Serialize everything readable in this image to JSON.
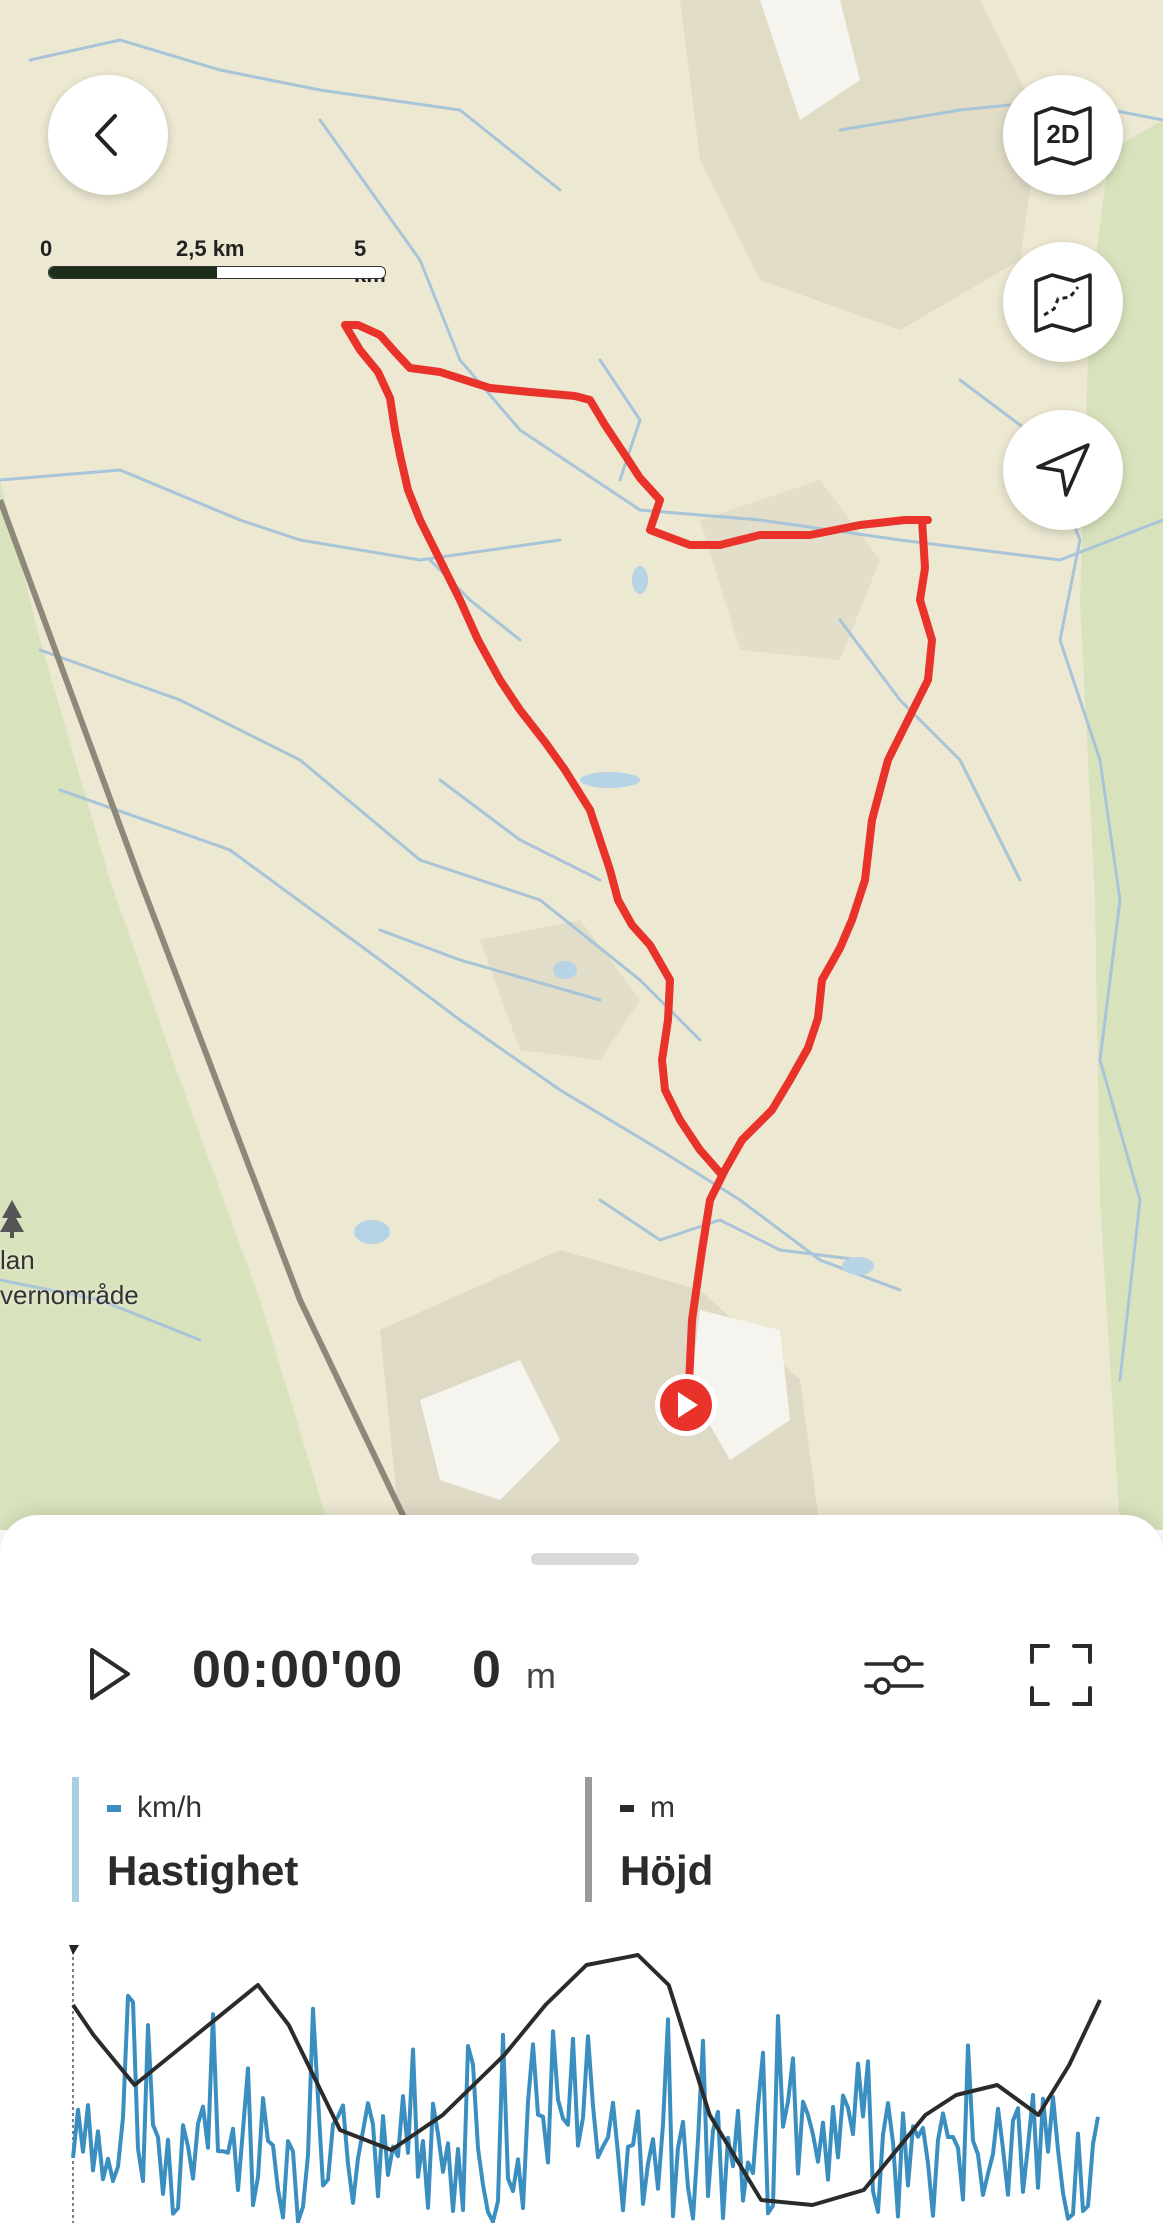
{
  "map": {
    "scale": {
      "zero": "0",
      "mid": "2,5 km",
      "end": "5 km"
    },
    "area_label_line1": "lan",
    "area_label_line2": "vernområde",
    "route_color": "#e8322a",
    "buttons": {
      "back": "back-icon",
      "view_2d": "2D",
      "map_style": "map-style-icon",
      "locate": "navigation-arrow-icon"
    }
  },
  "playback": {
    "time": "00:00'00",
    "distance_value": "0",
    "distance_unit": "m"
  },
  "metrics": [
    {
      "unit": "km/h",
      "title": "Hastighet",
      "color": "#3a8fc0",
      "bar_color": "#a8cfe2"
    },
    {
      "unit": "m",
      "title": "Höjd",
      "color": "#2b2b2b",
      "bar_color": "#9a9a9a"
    }
  ],
  "colors": {
    "speed_line": "#3a8fc0",
    "elevation_line": "#2b2b2b"
  }
}
